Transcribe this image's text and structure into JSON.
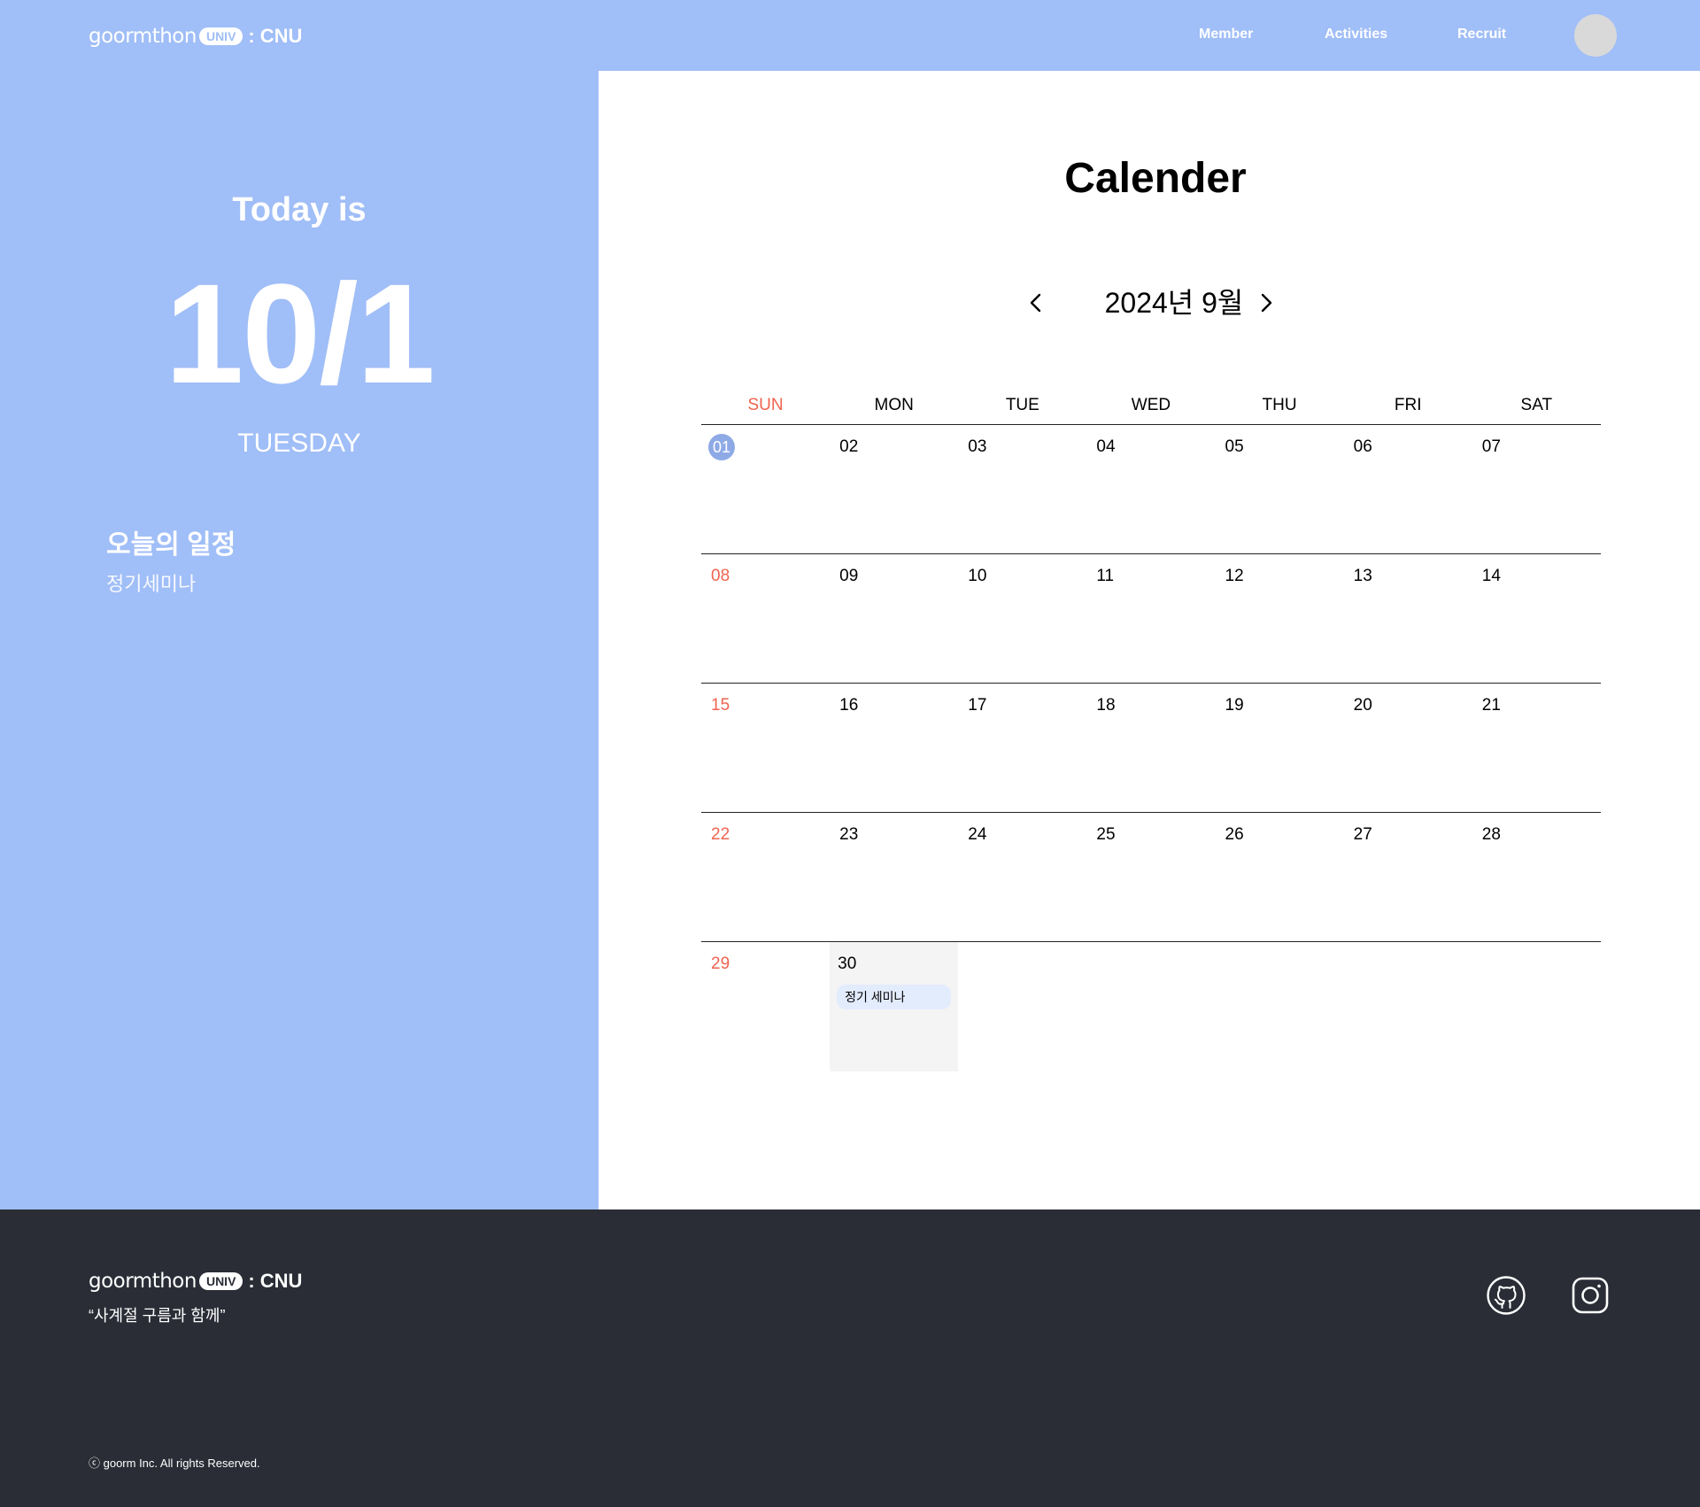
{
  "header": {
    "logo": {
      "brand": "goormthon",
      "badge": "UNIV",
      "separator": ":",
      "school": "CNU"
    },
    "nav": [
      "Member",
      "Activities",
      "Recruit"
    ]
  },
  "today": {
    "label": "Today is",
    "date": "10/1",
    "weekday": "TUESDAY",
    "schedule_title": "오늘의 일정",
    "schedule_item": "정기세미나"
  },
  "calendar": {
    "title": "Calender",
    "month_label": "2024년 9월",
    "weekdays": [
      "SUN",
      "MON",
      "TUE",
      "WED",
      "THU",
      "FRI",
      "SAT"
    ],
    "weeks": [
      [
        "01",
        "02",
        "03",
        "04",
        "05",
        "06",
        "07"
      ],
      [
        "08",
        "09",
        "10",
        "11",
        "12",
        "13",
        "14"
      ],
      [
        "15",
        "16",
        "17",
        "18",
        "19",
        "20",
        "21"
      ],
      [
        "22",
        "23",
        "24",
        "25",
        "26",
        "27",
        "28"
      ],
      [
        "29",
        "30",
        "",
        "",
        "",
        "",
        ""
      ]
    ],
    "event": {
      "day": "30",
      "label": "정기 세미나"
    },
    "colors": {
      "sunday": "#f0634f",
      "today_circle": "#8eaae6",
      "event_bg": "#e3ecfd",
      "panel": "#a0bef7"
    }
  },
  "footer": {
    "logo": {
      "brand": "goormthon",
      "badge": "UNIV",
      "separator": ":",
      "school": "CNU"
    },
    "slogan": "“사계절 구름과 함께”",
    "copyright": "ⓒ goorm Inc. All rights Reserved.",
    "social": [
      "github-icon",
      "instagram-icon"
    ]
  }
}
